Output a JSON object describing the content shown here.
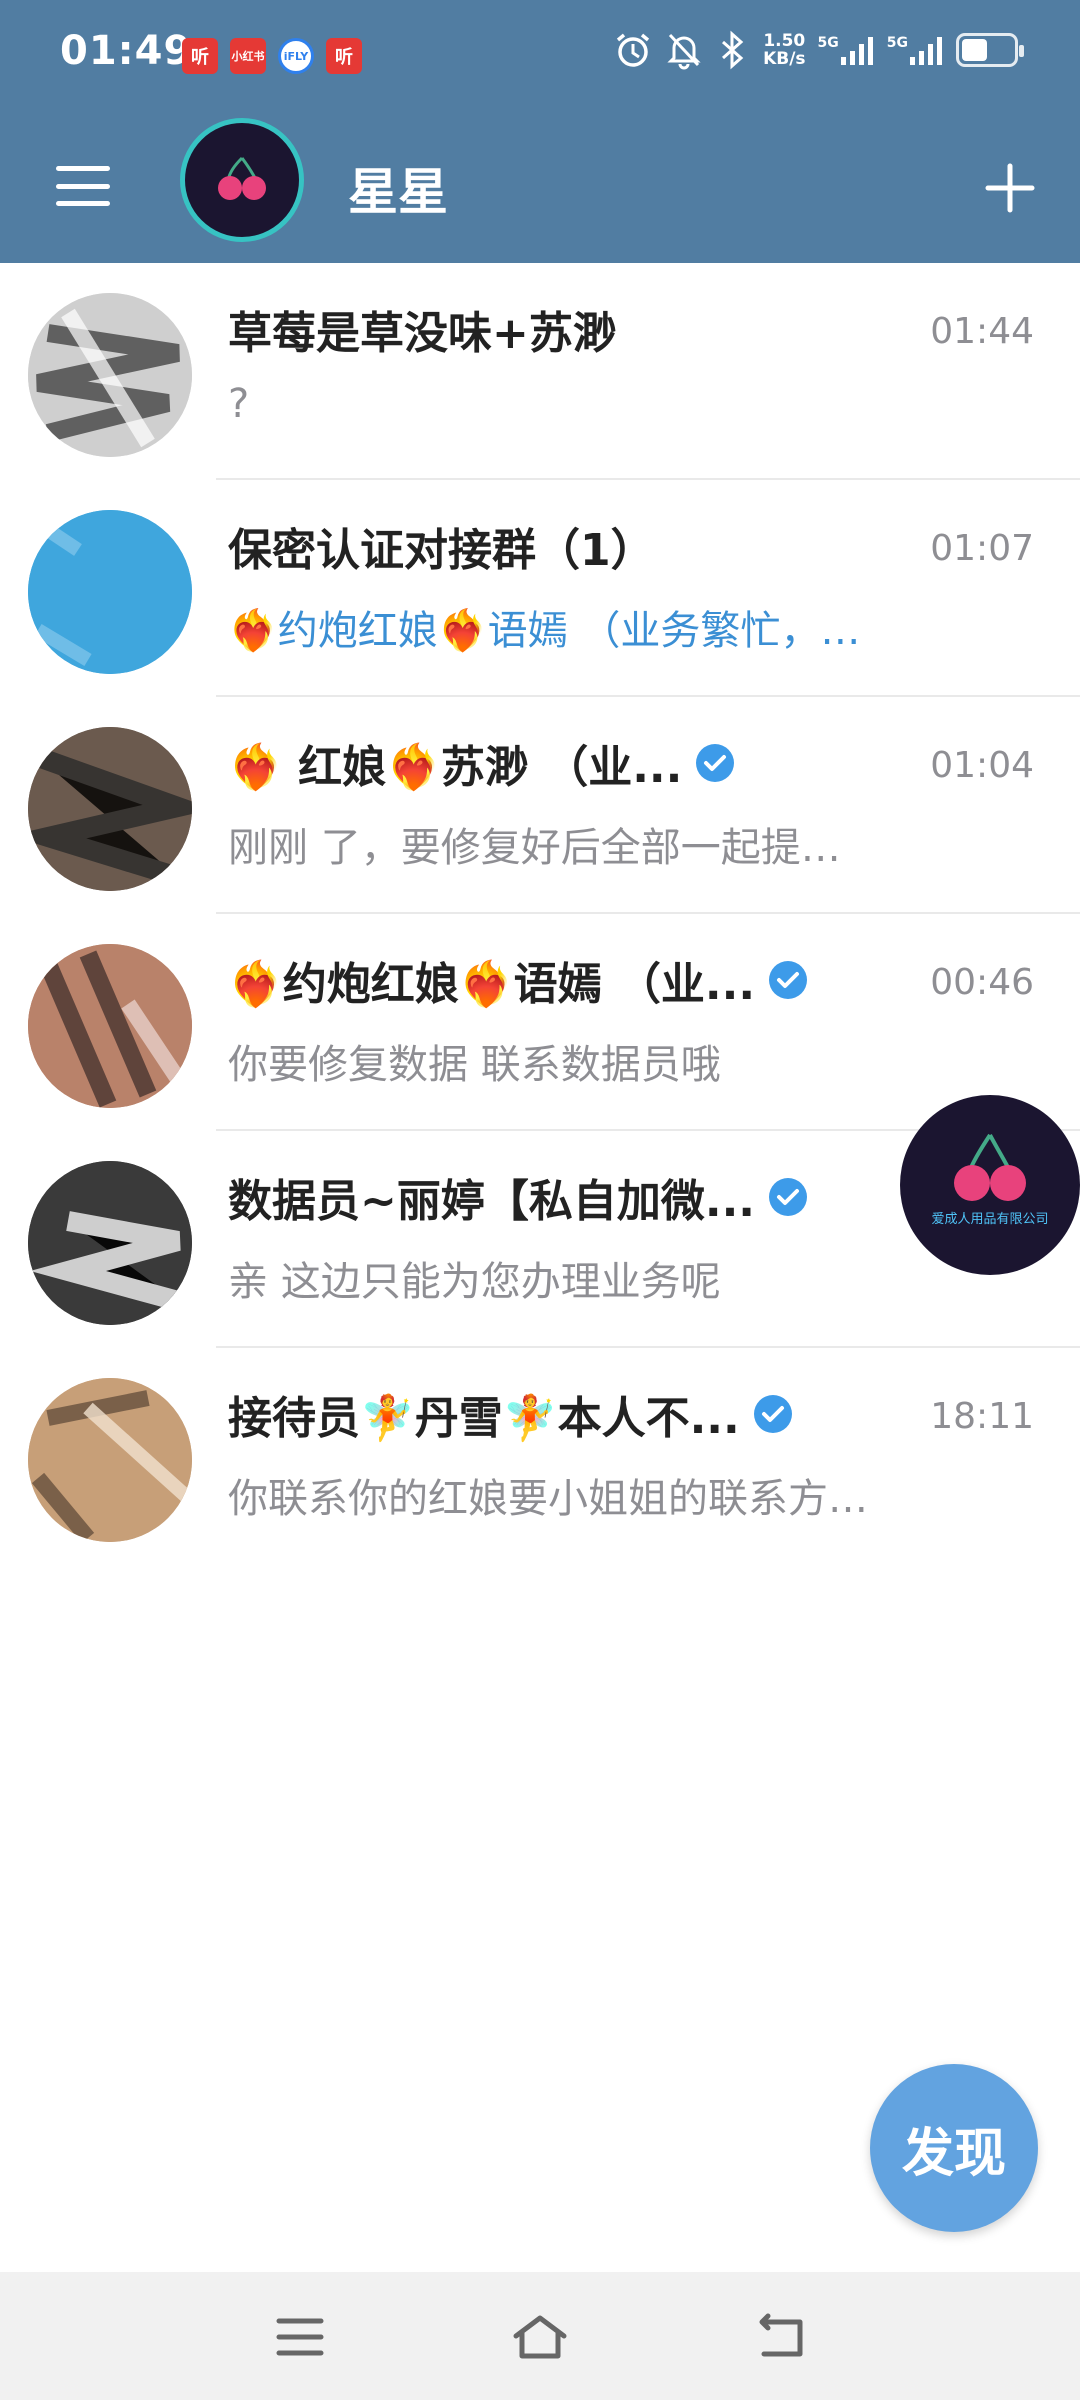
{
  "status_bar": {
    "time": "01:49",
    "notification_icons": [
      {
        "label": "听",
        "icon": "ting-app-icon"
      },
      {
        "label": "小红书",
        "icon": "xiaohongshu-app-icon"
      },
      {
        "label": "iFLY",
        "icon": "ifly-app-icon"
      },
      {
        "label": "听",
        "icon": "ting-app-icon"
      }
    ],
    "net_speed_value": "1.50",
    "net_speed_unit": "KB/s",
    "network_1": "5G",
    "network_2": "5G",
    "battery_level": 0.55
  },
  "app_bar": {
    "title": "星星",
    "menu_icon": "hamburger-menu-icon",
    "add_icon": "plus-icon"
  },
  "chats": [
    {
      "name": "草莓是草没味+苏渺",
      "time": "01:44",
      "message": "?",
      "verified": false,
      "draft": false
    },
    {
      "name": "保密认证对接群（1）",
      "time": "01:07",
      "message": "❤️‍🔥约炮红娘❤️‍🔥语嫣 （业务繁忙，…",
      "verified": false,
      "draft": true
    },
    {
      "name": "❤️‍🔥 红娘❤️‍🔥苏渺 （业...",
      "time": "01:04",
      "message": "刚刚 了，要修复好后全部一起提…",
      "verified": true,
      "draft": false
    },
    {
      "name": "❤️‍🔥约炮红娘❤️‍🔥语嫣 （业...",
      "time": "00:46",
      "message": "你要修复数据 联系数据员哦",
      "verified": true,
      "draft": false
    },
    {
      "name": "数据员~丽婷【私自加微...",
      "time": "",
      "message": "亲 这边只能为您办理业务呢",
      "verified": true,
      "draft": false
    },
    {
      "name": "接待员🧚丹雪🧚本人不...",
      "time": "18:11",
      "message": "你联系你的红娘要小姐姐的联系方…",
      "verified": true,
      "draft": false
    }
  ],
  "floating_avatar": {
    "text": "爱成人用品有限公司"
  },
  "discover_button": {
    "label": "发现"
  },
  "nav_bar": {
    "recent_icon": "recent-apps-icon",
    "home_icon": "home-icon",
    "back_icon": "back-icon"
  },
  "colors": {
    "header": "#517da2",
    "accent": "#62a3e0",
    "verified": "#3d9be9",
    "draft_text": "#3b8fd4"
  }
}
